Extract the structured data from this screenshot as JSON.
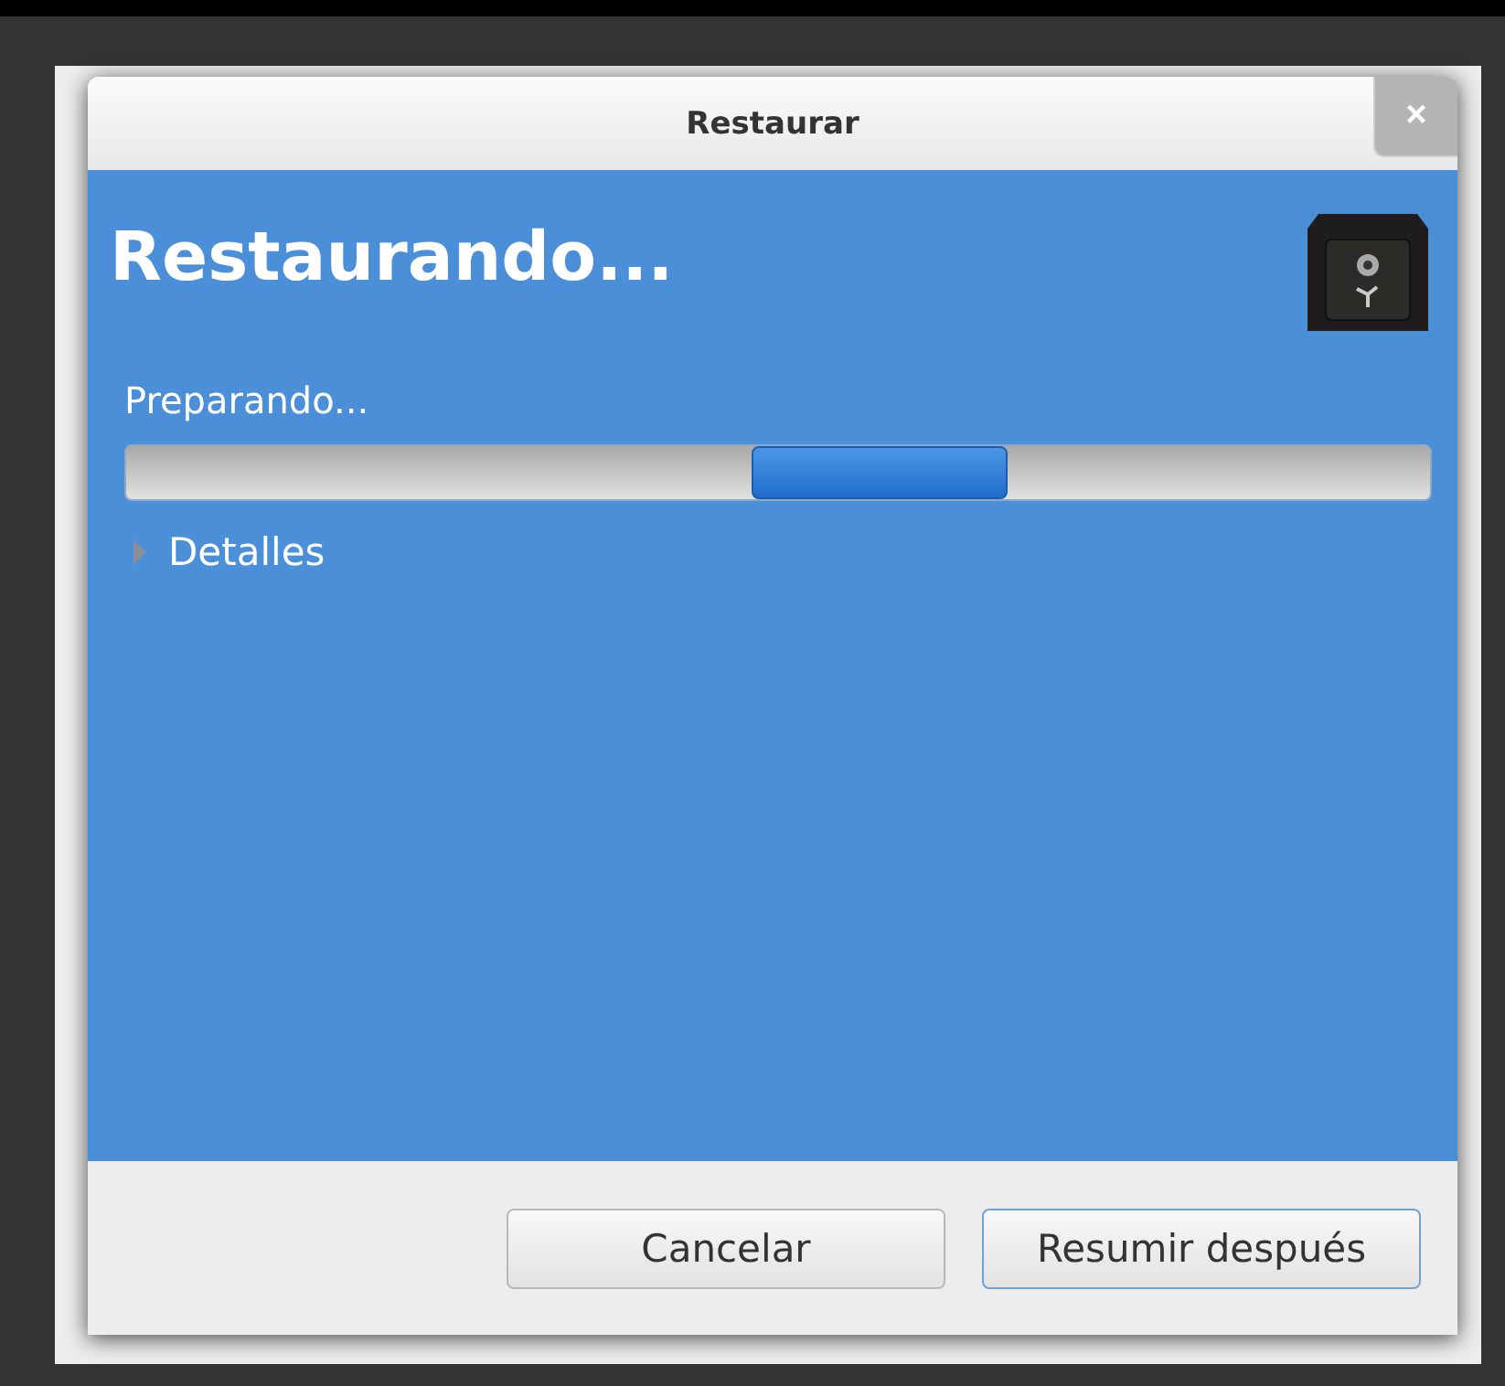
{
  "window": {
    "title": "Restaurar",
    "close_button": "×"
  },
  "heading": "Restaurando...",
  "status": "Preparando...",
  "progress": {
    "kind": "pulse"
  },
  "details": {
    "label": "Detalles",
    "expanded": false
  },
  "buttons": [
    {
      "label": "Cancelar",
      "focused": false
    },
    {
      "label": "Resumir después",
      "focused": true
    }
  ]
}
